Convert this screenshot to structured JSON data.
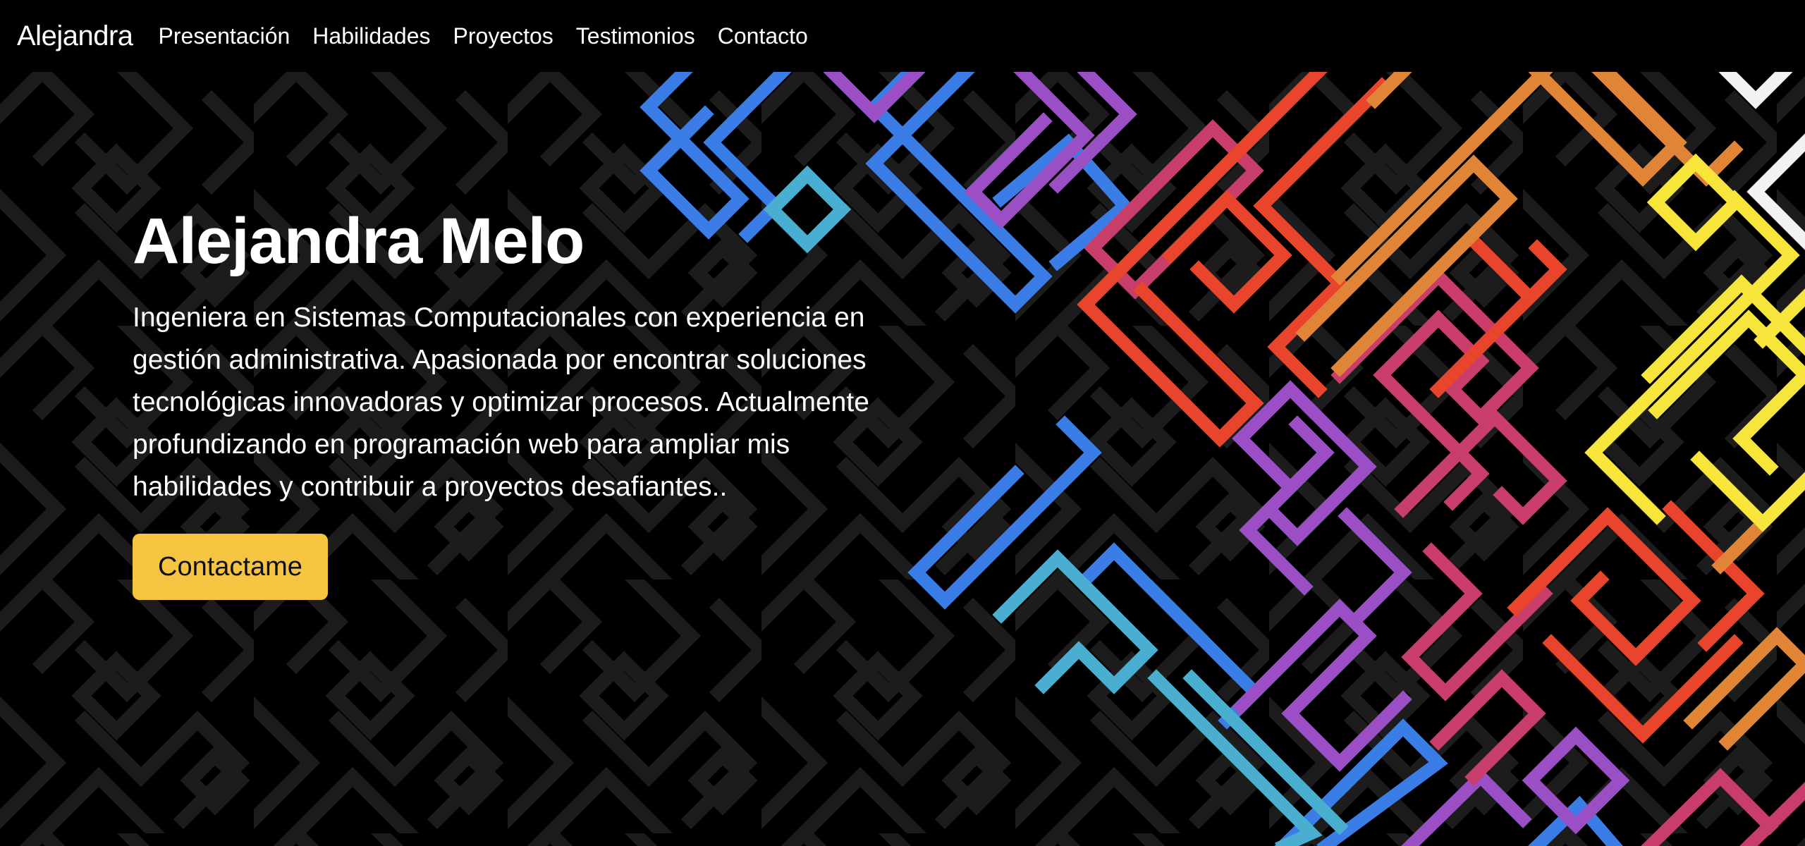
{
  "navbar": {
    "brand": "Alejandra",
    "links": [
      {
        "label": "Presentación"
      },
      {
        "label": "Habilidades"
      },
      {
        "label": "Proyectos"
      },
      {
        "label": "Testimonios"
      },
      {
        "label": "Contacto"
      }
    ]
  },
  "hero": {
    "title": "Alejandra Melo",
    "description": "Ingeniera en Sistemas Computacionales con experiencia en gestión administrativa. Apasionada por encontrar soluciones tecnológicas innovadoras y optimizar procesos. Actualmente profundizando en programación web para ampliar mis habilidades y contribuir a proyectos desafiantes..",
    "cta_label": "Contactame"
  },
  "colors": {
    "background": "#000000",
    "accent_button": "#f5c542",
    "maze_dark": "#1c1c1c",
    "maze_palette": [
      "#3b7de6",
      "#4aaed0",
      "#9b4fc4",
      "#c93d6a",
      "#e8452c",
      "#e08538",
      "#f7e53b",
      "#f2f2f2"
    ]
  }
}
